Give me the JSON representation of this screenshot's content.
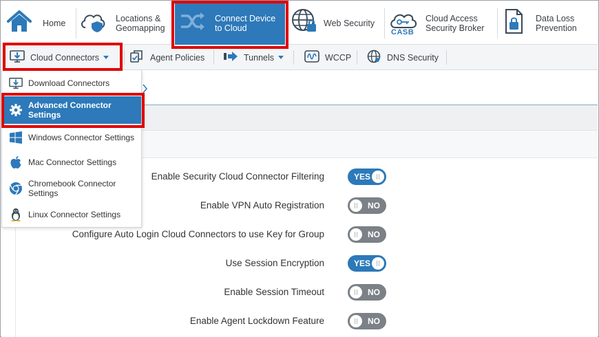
{
  "topnav": {
    "items": [
      {
        "label": "Home",
        "icon": "home-icon"
      },
      {
        "label": "Locations & Geomapping",
        "line1": "Locations &",
        "line2": "Geomapping",
        "icon": "cloud-shield-icon"
      },
      {
        "label": "Connect Device to Cloud",
        "line1": "Connect Device",
        "line2": "to Cloud",
        "icon": "shuffle-icon",
        "active": true
      },
      {
        "label": "Web Security",
        "icon": "globe-lock-icon"
      },
      {
        "label": "Cloud Access Security Broker",
        "line1": "Cloud Access",
        "line2": "Security Broker",
        "icon": "casb-cloud-key-icon",
        "icon_text": "CASB"
      },
      {
        "label": "Data Loss Prevention",
        "line1": "Data Loss",
        "line2": "Prevention",
        "icon": "document-lock-icon"
      }
    ]
  },
  "subnav": {
    "items": [
      {
        "label": "Cloud Connectors",
        "icon": "download-monitor-icon",
        "has_caret": true
      },
      {
        "label": "Agent Policies",
        "icon": "copy-documents-icon",
        "has_caret": false
      },
      {
        "label": "Tunnels",
        "icon": "arrow-right-icon",
        "has_caret": true
      },
      {
        "label": "WCCP",
        "icon": "waveform-icon",
        "has_caret": false
      },
      {
        "label": "DNS Security",
        "icon": "globe-icon",
        "has_caret": false
      }
    ]
  },
  "dropdown": {
    "items": [
      {
        "line1": "Download Connectors",
        "line2": "",
        "icon": "download-monitor-icon",
        "active": false
      },
      {
        "line1": "Advanced Connector",
        "line2": "Settings",
        "icon": "gear-icon",
        "active": true
      },
      {
        "line1": "Windows Connector Settings",
        "line2": "",
        "icon": "windows-icon",
        "active": false
      },
      {
        "line1": "Mac Connector Settings",
        "line2": "",
        "icon": "apple-icon",
        "active": false
      },
      {
        "line1": "Chromebook Connector",
        "line2": "Settings",
        "icon": "chrome-icon",
        "active": false
      },
      {
        "line1": "Linux Connector Settings",
        "line2": "",
        "icon": "linux-tux-icon",
        "active": false
      }
    ]
  },
  "settings": [
    {
      "label": "Enable Security Cloud Connector Filtering",
      "value": "YES",
      "on": true
    },
    {
      "label": "Enable VPN Auto Registration",
      "value": "NO",
      "on": false
    },
    {
      "label": "Configure Auto Login Cloud Connectors to use Key for Group",
      "value": "NO",
      "on": false
    },
    {
      "label": "Use Session Encryption",
      "value": "YES",
      "on": true
    },
    {
      "label": "Enable Session Timeout",
      "value": "NO",
      "on": false
    },
    {
      "label": "Enable Agent Lockdown Feature",
      "value": "NO",
      "on": false
    }
  ],
  "colors": {
    "accent": "#2d79b9",
    "toggle_off": "#7b8187",
    "highlight": "#e00000"
  }
}
